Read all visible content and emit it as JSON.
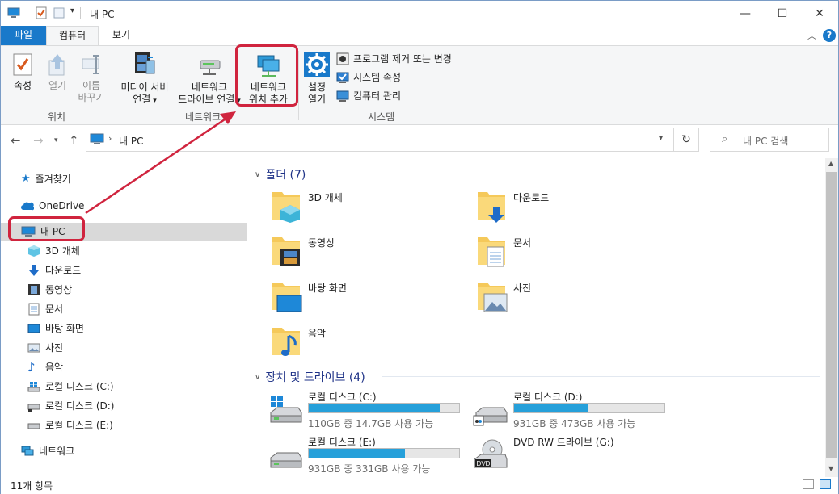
{
  "window": {
    "title": "내 PC",
    "path_label": "내 PC",
    "search_placeholder": "내 PC 검색"
  },
  "tabs": {
    "file": "파일",
    "computer": "컴퓨터",
    "view": "보기"
  },
  "ribbon": {
    "location": {
      "properties": "속성",
      "open": "열기",
      "rename_line1": "이름",
      "rename_line2": "바꾸기",
      "group": "위치"
    },
    "network": {
      "media_server_line1": "미디어 서버",
      "media_server_line2": "연결",
      "map_drive_line1": "네트워크",
      "map_drive_line2": "드라이브 연결",
      "add_location_line1": "네트워크",
      "add_location_line2": "위치 추가",
      "group": "네트워크"
    },
    "system": {
      "settings_line1": "설정",
      "settings_line2": "열기",
      "uninstall": "프로그램 제거 또는 변경",
      "system_properties": "시스템 속성",
      "manage": "컴퓨터 관리",
      "group": "시스템"
    }
  },
  "nav_pane": {
    "quick_access": "즐겨찾기",
    "onedrive": "OneDrive",
    "this_pc": "내 PC",
    "items": [
      "3D 개체",
      "다운로드",
      "동영상",
      "문서",
      "바탕 화면",
      "사진",
      "음악",
      "로컬 디스크 (C:)",
      "로컬 디스크 (D:)",
      "로컬 디스크 (E:)"
    ],
    "network": "네트워크"
  },
  "folders": {
    "header": "폴더 (7)",
    "items": [
      "3D 개체",
      "다운로드",
      "동영상",
      "문서",
      "바탕 화면",
      "사진",
      "음악"
    ]
  },
  "drives": {
    "header": "장치 및 드라이브 (4)",
    "items": [
      {
        "name": "로컬 디스크 (C:)",
        "free": "110GB 중 14.7GB 사용 가능",
        "used_fraction": 0.87
      },
      {
        "name": "로컬 디스크 (D:)",
        "free": "931GB 중 473GB 사용 가능",
        "used_fraction": 0.49
      },
      {
        "name": "로컬 디스크 (E:)",
        "free": "931GB 중 331GB 사용 가능",
        "used_fraction": 0.64
      },
      {
        "name": "DVD RW 드라이브 (G:)"
      }
    ]
  },
  "status": {
    "count": "11개 항목"
  },
  "colors": {
    "accent": "#1979ca",
    "highlight": "#d0243e",
    "drive_bar": "#26a0da"
  }
}
